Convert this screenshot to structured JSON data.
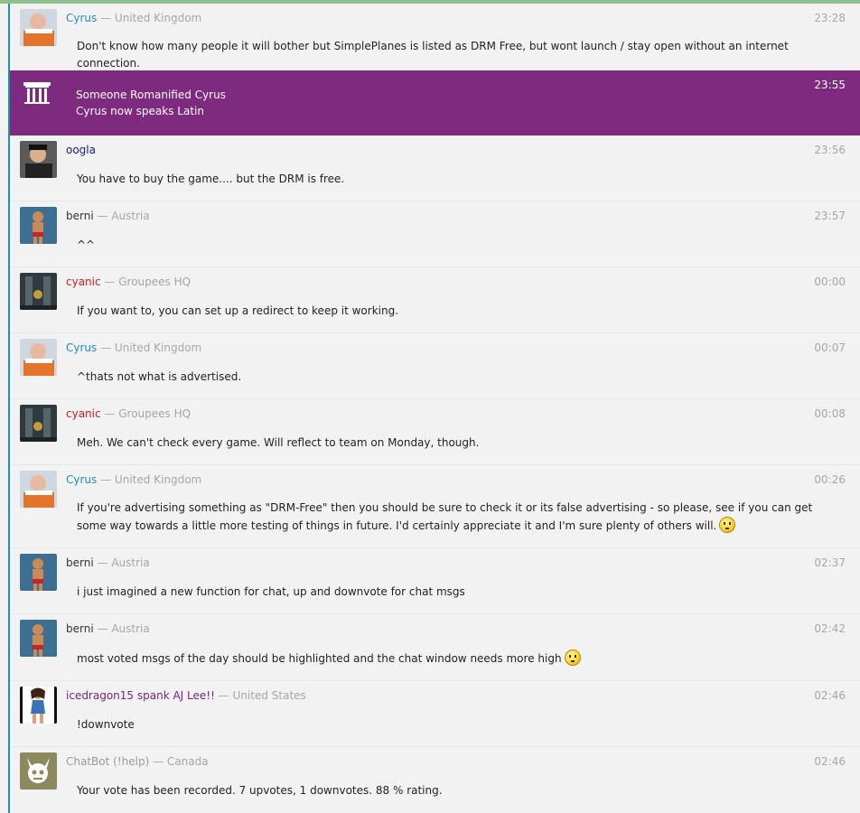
{
  "colors": {
    "top_accent": "#8fbf8f",
    "left_rule": "#1a8fc7",
    "system_bg": "#7e2a7f"
  },
  "system": {
    "icon": "column-icon",
    "line1": "Someone Romanified Cyrus",
    "line2": "Cyrus now speaks Latin",
    "time": "23:55"
  },
  "messages": [
    {
      "name": "Cyrus",
      "location": "— United Kingdom",
      "time": "23:28",
      "text": "Don't know how many people it will bother but SimplePlanes is listed as DRM Free, but wont launch / stay open without an internet connection."
    },
    {
      "name": "oogla",
      "location": "",
      "time": "23:56",
      "text": "You have to buy the game.... but the DRM is free."
    },
    {
      "name": "berni",
      "location": "— Austria",
      "time": "23:57",
      "text": "^^"
    },
    {
      "name": "cyanic",
      "location": "— Groupees HQ",
      "time": "00:00",
      "text": "If you want to, you can set up a redirect to keep it working."
    },
    {
      "name": "Cyrus",
      "location": "— United Kingdom",
      "time": "00:07",
      "text": "^thats not what is advertised."
    },
    {
      "name": "cyanic",
      "location": "— Groupees HQ",
      "time": "00:08",
      "text": "Meh. We can't check every game. Will reflect to team on Monday, though."
    },
    {
      "name": "Cyrus",
      "location": "— United Kingdom",
      "time": "00:26",
      "text": "If you're advertising something as \"DRM-Free\" then you should be sure to check it or its false advertising - so please, see if you can get some way towards a little more testing of things in future. I'd certainly appreciate it and I'm sure plenty of others will.",
      "emoji": "thinking-smiley-icon"
    },
    {
      "name": "berni",
      "location": "— Austria",
      "time": "02:37",
      "text": "i just imagined a new function for chat, up and downvote for chat msgs"
    },
    {
      "name": "berni",
      "location": "— Austria",
      "time": "02:42",
      "text": "most voted msgs of the day should be highlighted and the chat window needs more high",
      "emoji": "thinking-smiley-icon"
    },
    {
      "name": "icedragon15 spank AJ Lee!!",
      "location": "— United States",
      "time": "02:46",
      "text": "!downvote"
    },
    {
      "name": "ChatBot (!help)",
      "location": "— Canada",
      "time": "02:46",
      "text": "Your vote has been recorded. 7 upvotes, 1 downvotes. 88 % rating."
    }
  ]
}
